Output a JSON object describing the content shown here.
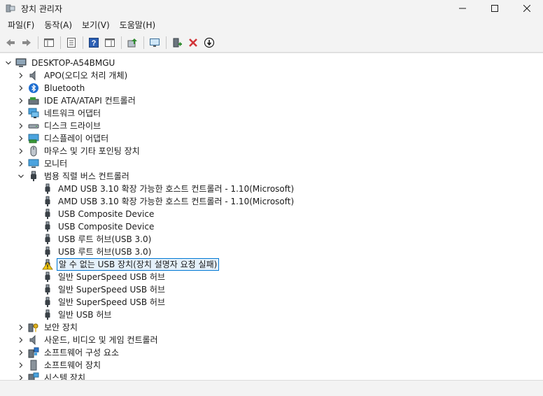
{
  "window": {
    "title": "장치 관리자"
  },
  "menu": {
    "file": "파일(F)",
    "action": "동작(A)",
    "view": "보기(V)",
    "help": "도움말(H)"
  },
  "tree": {
    "root": "DESKTOP-A54BMGU",
    "categories": [
      "APO(오디오 처리 개체)",
      "Bluetooth",
      "IDE ATA/ATAPI 컨트롤러",
      "네트워크 어댑터",
      "디스크 드라이브",
      "디스플레이 어댑터",
      "마우스 및 기타 포인팅 장치",
      "모니터",
      "범용 직렬 버스 컨트롤러"
    ],
    "usb_children": [
      "AMD USB 3.10 확장 가능한 호스트 컨트롤러 - 1.10(Microsoft)",
      "AMD USB 3.10 확장 가능한 호스트 컨트롤러 - 1.10(Microsoft)",
      "USB Composite Device",
      "USB Composite Device",
      "USB 루트 허브(USB 3.0)",
      "USB 루트 허브(USB 3.0)",
      "알 수 없는 USB 장치(장치 설명자 요청 실패)",
      "일반 SuperSpeed USB 허브",
      "일반 SuperSpeed USB 허브",
      "일반 SuperSpeed USB 허브",
      "일반 USB 허브"
    ],
    "categories_after": [
      "보안 장치",
      "사운드, 비디오 및 게임 컨트롤러",
      "소프트웨어 구성 요소",
      "소프트웨어 장치",
      "시스템 장치"
    ]
  },
  "colors": {
    "accent": "#0078d4",
    "warning": "#f2c811",
    "uninstall_red": "#d13438",
    "install_green": "#2e8b2e"
  }
}
